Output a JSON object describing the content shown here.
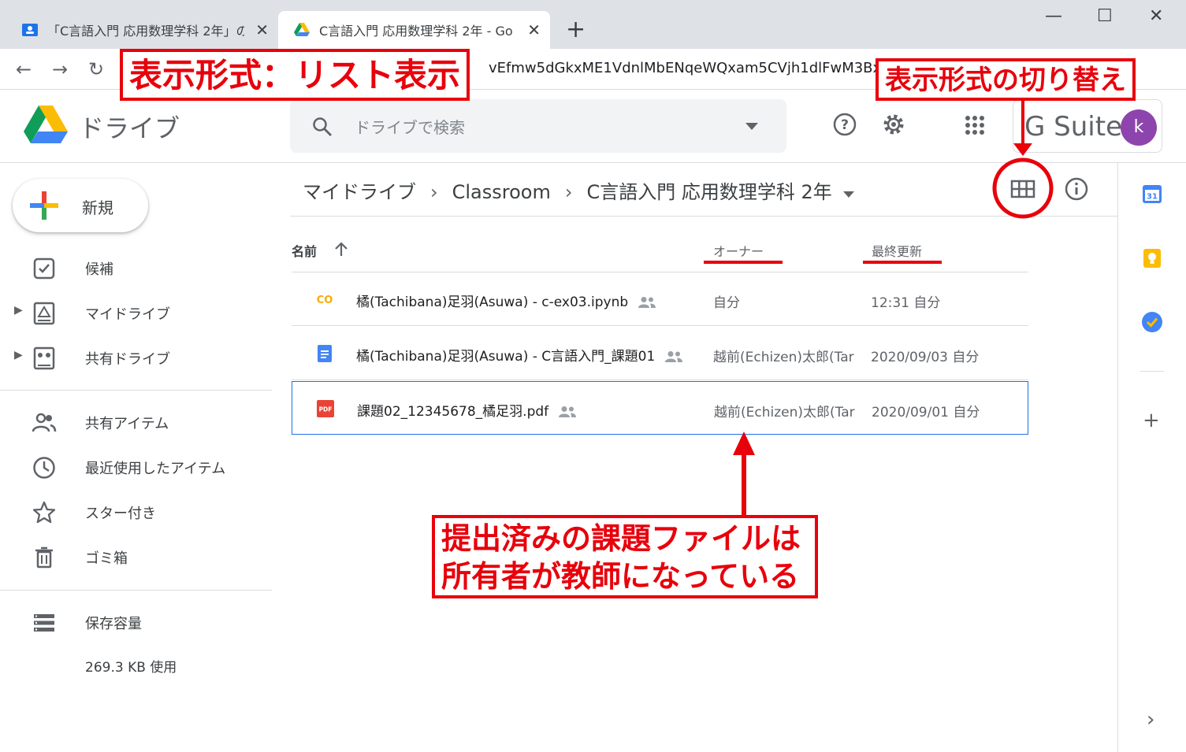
{
  "browser": {
    "tabs": [
      {
        "title": "「C言語入門 応用数理学科 2年」の",
        "active": false
      },
      {
        "title": "C言語入門 応用数理学科 2年 - Go",
        "active": true
      }
    ],
    "url": "vEfmw5dGkxME1VdnlMbENqeWQxam5CVjh1dlFwM3Bx"
  },
  "header": {
    "app_name": "ドライブ",
    "search_placeholder": "ドライブで検索",
    "gsuite": "G Suite",
    "avatar_letter": "k"
  },
  "sidebar": {
    "new_label": "新規",
    "items": [
      {
        "label": "候補"
      },
      {
        "label": "マイドライブ"
      },
      {
        "label": "共有ドライブ"
      },
      {
        "label": "共有アイテム"
      },
      {
        "label": "最近使用したアイテム"
      },
      {
        "label": "スター付き"
      },
      {
        "label": "ゴミ箱"
      },
      {
        "label": "保存容量"
      }
    ],
    "usage": "269.3 KB 使用"
  },
  "breadcrumb": [
    "マイドライブ",
    "Classroom",
    "C言語入門 応用数理学科 2年"
  ],
  "columns": {
    "name": "名前",
    "owner": "オーナー",
    "modified": "最終更新"
  },
  "files": [
    {
      "name": "橘(Tachibana)足羽(Asuwa) - c-ex03.ipynb",
      "owner": "自分",
      "modified": "12:31 自分",
      "type": "colab"
    },
    {
      "name": "橘(Tachibana)足羽(Asuwa) - C言語入門_課題01",
      "owner": "越前(Echizen)太郎(Tar",
      "modified": "2020/09/03 自分",
      "type": "doc"
    },
    {
      "name": "課題02_12345678_橘足羽.pdf",
      "owner": "越前(Echizen)太郎(Tar",
      "modified": "2020/09/01 自分",
      "type": "pdf"
    }
  ],
  "annotations": {
    "list_view": "表示形式：リスト表示",
    "toggle": "表示形式の切り替え",
    "note_line1": "提出済みの課題ファイルは",
    "note_line2": "所有者が教師になっている"
  },
  "colors": {
    "annotation_red": "#e8000b",
    "selection_blue": "#1a73e8"
  }
}
